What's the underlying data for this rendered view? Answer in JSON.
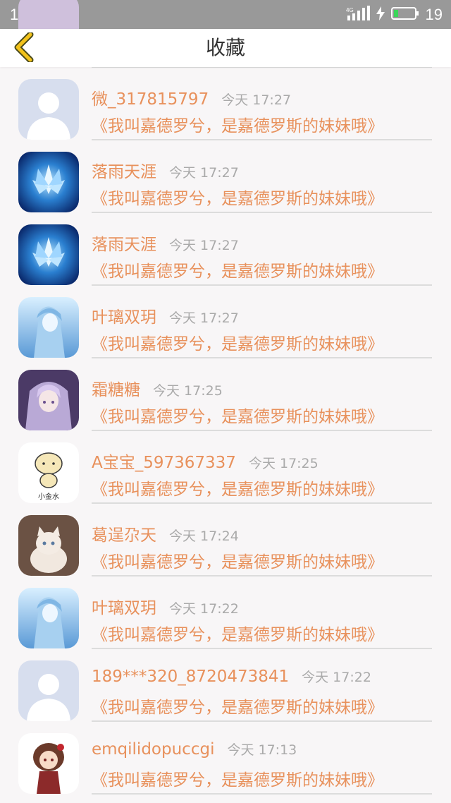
{
  "status_bar": {
    "time": "18:00",
    "network": "4G",
    "battery_percent": "19",
    "icons": [
      "chat-bubble-icon",
      "signal-icon",
      "charging-icon",
      "battery-icon"
    ]
  },
  "header": {
    "title": "收藏",
    "back_icon": "chevron-left-icon",
    "accent_color": "#f2c21b"
  },
  "colors": {
    "name_text": "#e8915c",
    "time_text": "#aaaaaa",
    "divider": "#dcdcdc",
    "background": "#f8f6f7"
  },
  "items": [
    {
      "name": "",
      "time": "",
      "text": "",
      "avatar": "purple-partial-avatar"
    },
    {
      "name": "微_317815797",
      "time": "今天 17:27",
      "text": "《我叫嘉德罗兮，是嘉德罗斯的妹妹哦》",
      "avatar": "default-person-avatar"
    },
    {
      "name": "落雨天涯",
      "time": "今天 17:27",
      "text": "《我叫嘉德罗兮，是嘉德罗斯的妹妹哦》",
      "avatar": "blue-crystal-flower-avatar"
    },
    {
      "name": "落雨天涯",
      "time": "今天 17:27",
      "text": "《我叫嘉德罗兮，是嘉德罗斯的妹妹哦》",
      "avatar": "blue-crystal-flower-avatar"
    },
    {
      "name": "叶璃双玥",
      "time": "今天 17:27",
      "text": "《我叫嘉德罗兮，是嘉德罗斯的妹妹哦》",
      "avatar": "anime-blue-hair-avatar"
    },
    {
      "name": "霜糖糖",
      "time": "今天 17:25",
      "text": "《我叫嘉德罗兮，是嘉德罗斯的妹妹哦》",
      "avatar": "anime-purple-girl-avatar"
    },
    {
      "name": "A宝宝_597367337",
      "time": "今天 17:25",
      "text": "《我叫嘉德罗兮，是嘉德罗斯的妹妹哦》",
      "avatar": "cartoon-xiaojinshui-avatar",
      "avatar_caption": "小金水"
    },
    {
      "name": "葛逞尕天",
      "time": "今天 17:24",
      "text": "《我叫嘉德罗兮，是嘉德罗斯的妹妹哦》",
      "avatar": "cat-avatar"
    },
    {
      "name": "叶璃双玥",
      "time": "今天 17:22",
      "text": "《我叫嘉德罗兮，是嘉德罗斯的妹妹哦》",
      "avatar": "anime-blue-hair-avatar"
    },
    {
      "name": "189***320_8720473841",
      "time": "今天 17:22",
      "text": "《我叫嘉德罗兮，是嘉德罗斯的妹妹哦》",
      "avatar": "default-person-avatar"
    },
    {
      "name": "emqilidopuccgi",
      "time": "今天 17:13",
      "text": "《我叫嘉德罗兮，是嘉德罗斯的妹妹哦》",
      "avatar": "chibi-girl-avatar"
    }
  ]
}
